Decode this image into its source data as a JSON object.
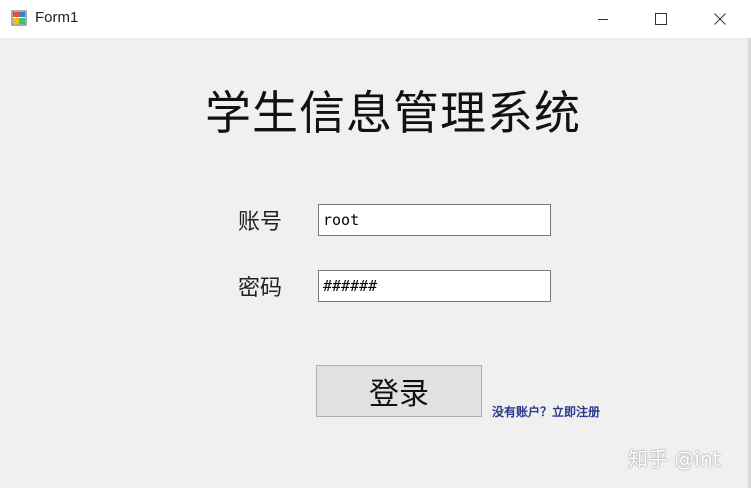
{
  "window": {
    "title": "Form1",
    "icon": "winforms-app-icon",
    "controls": {
      "minimize": "minimize-icon",
      "maximize": "maximize-icon",
      "close": "close-icon"
    }
  },
  "form": {
    "heading": "学生信息管理系统",
    "account_label": "账号",
    "account_value": "root",
    "password_label": "密码",
    "password_value": "######",
    "login_label": "登录",
    "register_link": "没有账户？立即注册"
  },
  "watermark": "知乎 @int",
  "colors": {
    "background": "#f0f0f0",
    "titlebar": "#ffffff",
    "button": "#e1e1e1",
    "link": "#2b3a8c"
  }
}
